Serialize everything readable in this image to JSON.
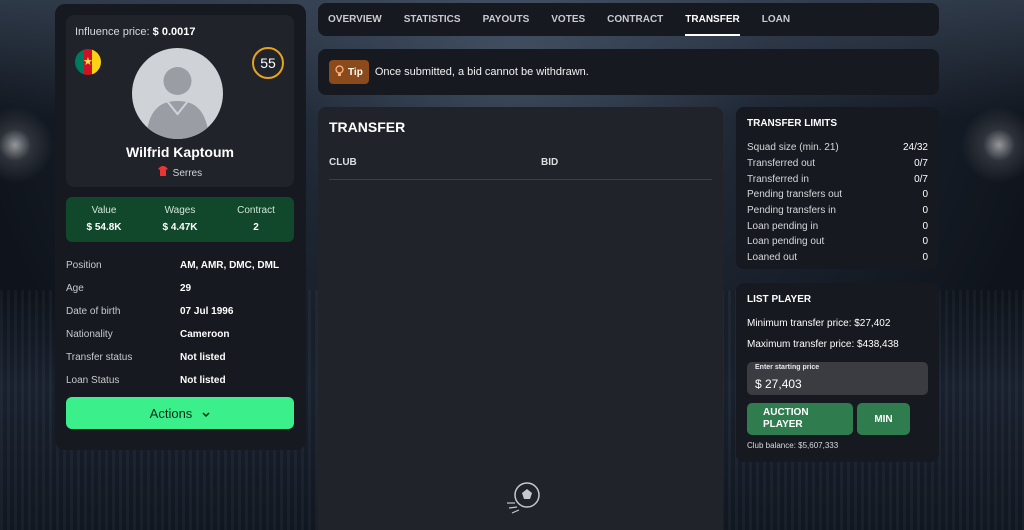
{
  "player": {
    "influence_label": "Influence price:",
    "influence_value": "$ 0.0017",
    "rating": "55",
    "name": "Wilfrid Kaptoum",
    "club": "Serres",
    "flag_colors": [
      "#007a5e",
      "#ce1126",
      "#fcd116"
    ]
  },
  "stats": [
    {
      "label": "Value",
      "value": "$ 54.8K"
    },
    {
      "label": "Wages",
      "value": "$ 4.47K"
    },
    {
      "label": "Contract",
      "value": "2"
    }
  ],
  "details": [
    {
      "label": "Position",
      "value": "AM, AMR, DMC, DML"
    },
    {
      "label": "Age",
      "value": "29"
    },
    {
      "label": "Date of birth",
      "value": "07 Jul 1996"
    },
    {
      "label": "Nationality",
      "value": "Cameroon"
    },
    {
      "label": "Transfer status",
      "value": "Not listed"
    },
    {
      "label": "Loan Status",
      "value": "Not listed"
    }
  ],
  "actions_label": "Actions",
  "tabs": [
    {
      "label": "OVERVIEW"
    },
    {
      "label": "STATISTICS"
    },
    {
      "label": "PAYOUTS"
    },
    {
      "label": "VOTES"
    },
    {
      "label": "CONTRACT"
    },
    {
      "label": "TRANSFER"
    },
    {
      "label": "LOAN"
    }
  ],
  "active_tab": "TRANSFER",
  "tip": {
    "badge": "Tip",
    "text": "Once submitted, a bid cannot be withdrawn."
  },
  "transfer": {
    "title": "TRANSFER",
    "col_club": "CLUB",
    "col_bid": "BID"
  },
  "limits": {
    "title": "TRANSFER LIMITS",
    "rows": [
      {
        "label": "Squad size (min. 21)",
        "value": "24/32"
      },
      {
        "label": "Transferred out",
        "value": "0/7"
      },
      {
        "label": "Transferred in",
        "value": "0/7"
      },
      {
        "label": "Pending transfers out",
        "value": "0"
      },
      {
        "label": "Pending transfers in",
        "value": "0"
      },
      {
        "label": "Loan pending in",
        "value": "0"
      },
      {
        "label": "Loan pending out",
        "value": "0"
      },
      {
        "label": "Loaned out",
        "value": "0"
      }
    ]
  },
  "list_player": {
    "title": "LIST PLAYER",
    "min_price": "Minimum transfer price: $27,402",
    "max_price": "Maximum transfer price: $438,438",
    "start_label": "Enter starting price",
    "start_value": "$ 27,403",
    "auction_label": "AUCTION PLAYER",
    "min_label": "MIN",
    "balance": "Club balance: $5,607,333"
  },
  "colors": {
    "accent_green": "#3bf08a",
    "rating_ring": "#e7a21d",
    "tip_badge": "#8a4a1c"
  }
}
